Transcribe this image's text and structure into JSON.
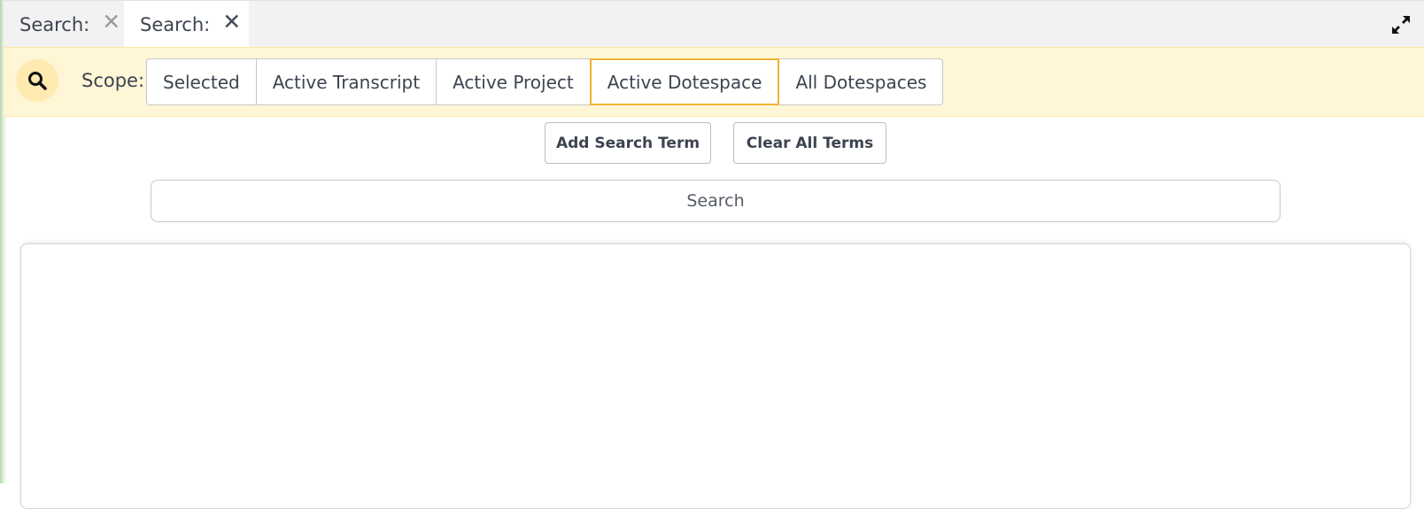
{
  "tabs": [
    {
      "label": "Search:",
      "close": "✕",
      "active": false
    },
    {
      "label": "Search:",
      "close": "✕",
      "active": true
    }
  ],
  "window": {
    "expand_icon": "expand-arrows-icon"
  },
  "scope": {
    "icon": "search-icon",
    "label": "Scope:",
    "options": [
      "Selected",
      "Active Transcript",
      "Active Project",
      "Active Dotespace",
      "All Dotespaces"
    ],
    "selected": "Active Dotespace"
  },
  "actions": {
    "add_term": "Add Search Term",
    "clear_terms": "Clear All Terms"
  },
  "search": {
    "placeholder": "Search",
    "value": ""
  },
  "colors": {
    "scope_bar_bg": "#fff6d6",
    "active_outline": "#f2b233",
    "text": "#3d4450"
  }
}
